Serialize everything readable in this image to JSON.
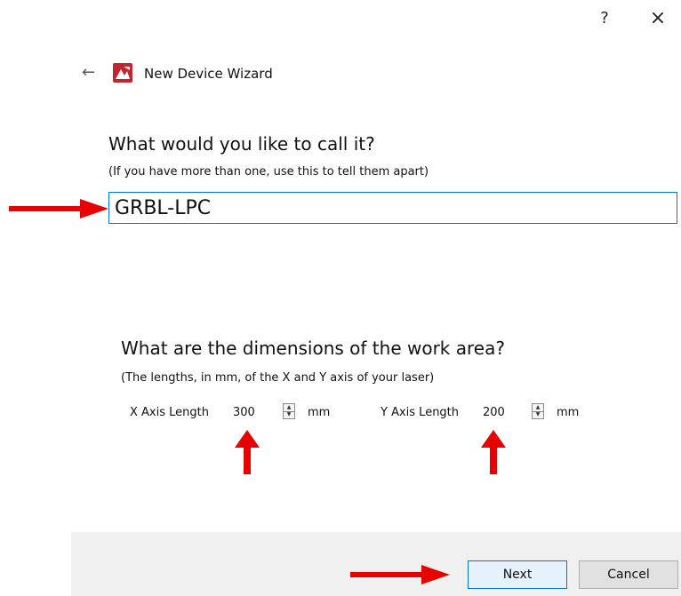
{
  "titlebar": {
    "help_label": "?",
    "close_label": "×"
  },
  "wizard": {
    "back_icon": "←",
    "title": "New Device Wizard",
    "logo_icon": "app-logo"
  },
  "name_section": {
    "heading": "What would you like to call it?",
    "subtitle": "(If you have more than one, use this to tell them apart)",
    "value": "GRBL-LPC"
  },
  "dims_section": {
    "heading": "What are the dimensions of the work area?",
    "subtitle": "(The lengths, in mm, of the X and Y axis of your laser)",
    "x_label": "X Axis Length",
    "x_value": "300",
    "x_unit": "mm",
    "y_label": "Y Axis Length",
    "y_value": "200",
    "y_unit": "mm"
  },
  "footer": {
    "next_label": "Next",
    "cancel_label": "Cancel"
  },
  "annotation_color": "#e60000"
}
